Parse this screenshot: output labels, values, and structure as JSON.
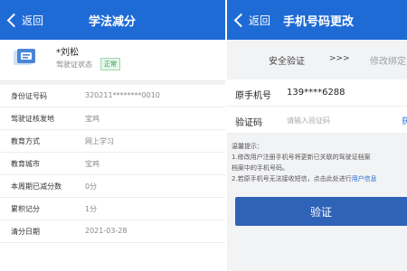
{
  "colors": {
    "nav": "#1f6bd6",
    "accent": "#1f6bd6",
    "badge": "#2e9a4a",
    "button": "#2f63b8"
  },
  "left": {
    "back_label": "返回",
    "title": "学法减分",
    "profile": {
      "name": "*刘松",
      "status_label": "驾驶证状态",
      "status_badge": "正常",
      "icon": "license-card-icon"
    },
    "rows": [
      {
        "label": "身份证号码",
        "value": "320211********0010"
      },
      {
        "label": "驾驶证核发地",
        "value": "宝鸡"
      },
      {
        "label": "教育方式",
        "value": "网上学习"
      },
      {
        "label": "教育城市",
        "value": "宝鸡"
      },
      {
        "label": "本周期已减分数",
        "value": "0分"
      },
      {
        "label": "累积记分",
        "value": "1分"
      },
      {
        "label": "清分日期",
        "value": "2021-03-28"
      }
    ]
  },
  "right": {
    "back_label": "返回",
    "title": "手机号码更改",
    "steps": {
      "step1": "安全验证",
      "arrows": ">>>",
      "step2": "修改绑定"
    },
    "form": {
      "old_phone_label": "原手机号",
      "old_phone_value": "139****6288",
      "code_label": "验证码",
      "code_placeholder": "请输入验证码",
      "get_code_label": "获"
    },
    "tips": {
      "heading": "温馨提示：",
      "line1": "1.修改用户注册手机号将更新已关联的驾驶证档案",
      "line1b": "档案中的手机号码。",
      "line2": "2.若原手机号无法接收短信，点击此处进行",
      "line2_link": "用户信息"
    },
    "verify_label": "验证"
  }
}
